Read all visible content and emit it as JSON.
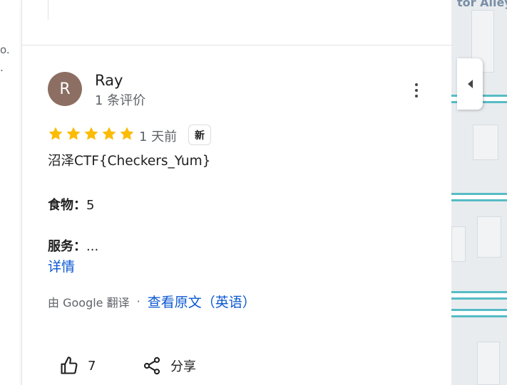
{
  "left_panel": {
    "fragment_1": "o.",
    "fragment_2": "."
  },
  "review": {
    "avatar_letter": "R",
    "avatar_color": "#8d6e63",
    "reviewer_name": "Ray",
    "reviewer_meta": "1 条评价",
    "rating": 5,
    "max_rating": 5,
    "star_color": "#fbbc04",
    "date": "1 天前",
    "new_badge": "新",
    "text": "沼泽CTF{Checkers_Yum}",
    "food_label": "食物：",
    "food_value": "5",
    "service_label": "服务：",
    "service_value": "...",
    "details_link": "详情",
    "translated_by": "由 Google 翻译",
    "separator": "·",
    "view_original": "查看原文（英语）",
    "like_count": "7",
    "share_label": "分享",
    "link_color": "#0b57d0"
  },
  "map": {
    "street_label": "tor Alley"
  },
  "icons": {
    "more": "more-vert-icon",
    "star": "star-icon",
    "like": "thumb-up-icon",
    "share": "share-icon",
    "collapse": "collapse-arrow-icon"
  }
}
